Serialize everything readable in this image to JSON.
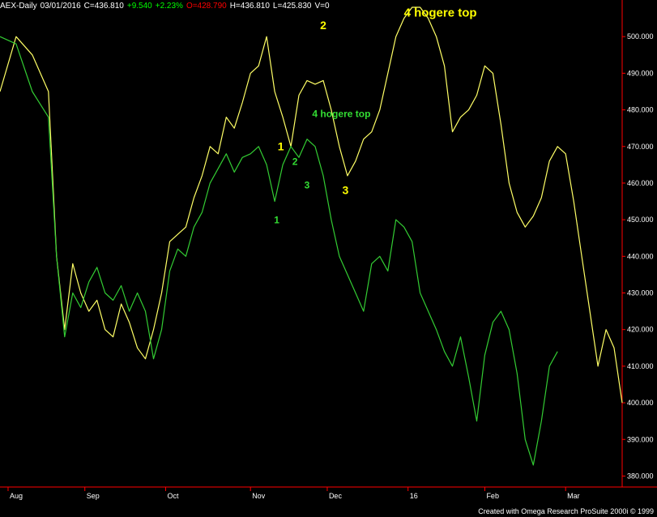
{
  "header": {
    "symbol": "AEX-Daily",
    "date": "03/01/2016",
    "close": "C=436.810",
    "change": "+9.540",
    "change_pct": "+2.23%",
    "open": "O=428.790",
    "high": "H=436.810",
    "low": "L=425.830",
    "volume": "V=0"
  },
  "credit": "Created with Omega Research ProSuite 2000i © 1999",
  "colors": {
    "background": "#000000",
    "frame": "#ff0000",
    "yellow_series": "#ffff66",
    "green_series": "#33cc33",
    "axis_text": "#ffffff",
    "header_white": "#ffffff",
    "header_green": "#00ff00",
    "header_red": "#ff0000",
    "annot_yellow": "#ffff00",
    "annot_green": "#33dd33"
  },
  "chart_data": {
    "type": "line",
    "title": "",
    "xlabel": "",
    "ylabel": "",
    "ylim": [
      377,
      510
    ],
    "xlim": [
      0,
      154
    ],
    "y_ticks": [
      380,
      390,
      400,
      410,
      420,
      430,
      440,
      450,
      460,
      470,
      480,
      490,
      500
    ],
    "y_tick_labels": [
      "380.000",
      "390.000",
      "400.000",
      "410.000",
      "420.000",
      "430.000",
      "440.000",
      "450.000",
      "460.000",
      "470.000",
      "480.000",
      "490.000",
      "500.000"
    ],
    "x_ticks": [
      {
        "label": "Aug",
        "x": 2
      },
      {
        "label": "Sep",
        "x": 21
      },
      {
        "label": "Oct",
        "x": 41
      },
      {
        "label": "Nov",
        "x": 62
      },
      {
        "label": "Dec",
        "x": 81
      },
      {
        "label": "16",
        "x": 101
      },
      {
        "label": "Feb",
        "x": 120
      },
      {
        "label": "Mar",
        "x": 140
      }
    ],
    "grid": false,
    "series": [
      {
        "color": "#ffff66",
        "x": [
          0,
          4,
          8,
          12,
          14,
          16,
          18,
          20,
          22,
          24,
          26,
          28,
          30,
          32,
          34,
          36,
          38,
          40,
          42,
          44,
          46,
          48,
          50,
          52,
          54,
          56,
          58,
          60,
          62,
          64,
          66,
          68,
          70,
          72,
          74,
          76,
          78,
          80,
          82,
          84,
          86,
          88,
          90,
          92,
          94,
          96,
          98,
          100,
          102,
          104,
          106,
          108,
          110,
          112,
          114,
          116,
          118,
          120,
          122,
          124,
          126,
          128,
          130,
          132,
          134,
          136,
          138,
          140,
          142,
          144,
          146,
          148,
          150,
          152,
          154
        ],
        "y": [
          485,
          500,
          495,
          485,
          440,
          420,
          438,
          430,
          425,
          428,
          420,
          418,
          427,
          422,
          415,
          412,
          420,
          430,
          444,
          446,
          448,
          456,
          462,
          470,
          468,
          478,
          475,
          482,
          490,
          492,
          500,
          485,
          478,
          470,
          484,
          488,
          487,
          488,
          480,
          470,
          462,
          466,
          472,
          474,
          480,
          490,
          500,
          505,
          508,
          508,
          505,
          500,
          492,
          474,
          478,
          480,
          484,
          492,
          490,
          476,
          460,
          452,
          448,
          451,
          456,
          466,
          470,
          468,
          455,
          440,
          425,
          410,
          420,
          415,
          400
        ]
      },
      {
        "color": "#33cc33",
        "x": [
          0,
          4,
          8,
          12,
          14,
          16,
          18,
          20,
          22,
          24,
          26,
          28,
          30,
          32,
          34,
          36,
          38,
          40,
          42,
          44,
          46,
          48,
          50,
          52,
          54,
          56,
          58,
          60,
          62,
          64,
          66,
          68,
          70,
          72,
          74,
          76,
          78,
          80,
          82,
          84,
          86,
          88,
          90,
          92,
          94,
          96,
          98,
          100,
          102,
          104,
          106,
          108,
          110,
          112,
          114,
          116,
          118,
          120,
          122,
          124,
          126,
          128,
          130,
          132,
          134,
          136,
          138
        ],
        "y": [
          500,
          498,
          485,
          478,
          440,
          418,
          430,
          426,
          433,
          437,
          430,
          428,
          432,
          425,
          430,
          425,
          412,
          420,
          436,
          442,
          440,
          448,
          452,
          460,
          464,
          468,
          463,
          467,
          468,
          470,
          465,
          455,
          465,
          470,
          467,
          472,
          470,
          462,
          450,
          440,
          435,
          430,
          425,
          438,
          440,
          436,
          450,
          448,
          444,
          430,
          425,
          420,
          414,
          410,
          418,
          407,
          395,
          413,
          422,
          425,
          420,
          408,
          390,
          383,
          395,
          410,
          414
        ]
      }
    ],
    "annotations": [
      {
        "text": "4 hogere top",
        "x": 109,
        "y": 505.5,
        "color": "#ffff00",
        "size": 15
      },
      {
        "text": "2",
        "x": 80,
        "y": 502,
        "color": "#ffff00",
        "size": 14
      },
      {
        "text": "1",
        "x": 69.5,
        "y": 469,
        "color": "#ffff00",
        "size": 14
      },
      {
        "text": "3",
        "x": 85.5,
        "y": 457,
        "color": "#ffff00",
        "size": 14
      },
      {
        "text": "4 hogere top",
        "x": 84.5,
        "y": 478,
        "color": "#33dd33",
        "size": 12
      },
      {
        "text": "2",
        "x": 73,
        "y": 465,
        "color": "#33dd33",
        "size": 12
      },
      {
        "text": "3",
        "x": 76,
        "y": 458.5,
        "color": "#33dd33",
        "size": 12
      },
      {
        "text": "1",
        "x": 68.5,
        "y": 449,
        "color": "#33dd33",
        "size": 12
      }
    ]
  }
}
